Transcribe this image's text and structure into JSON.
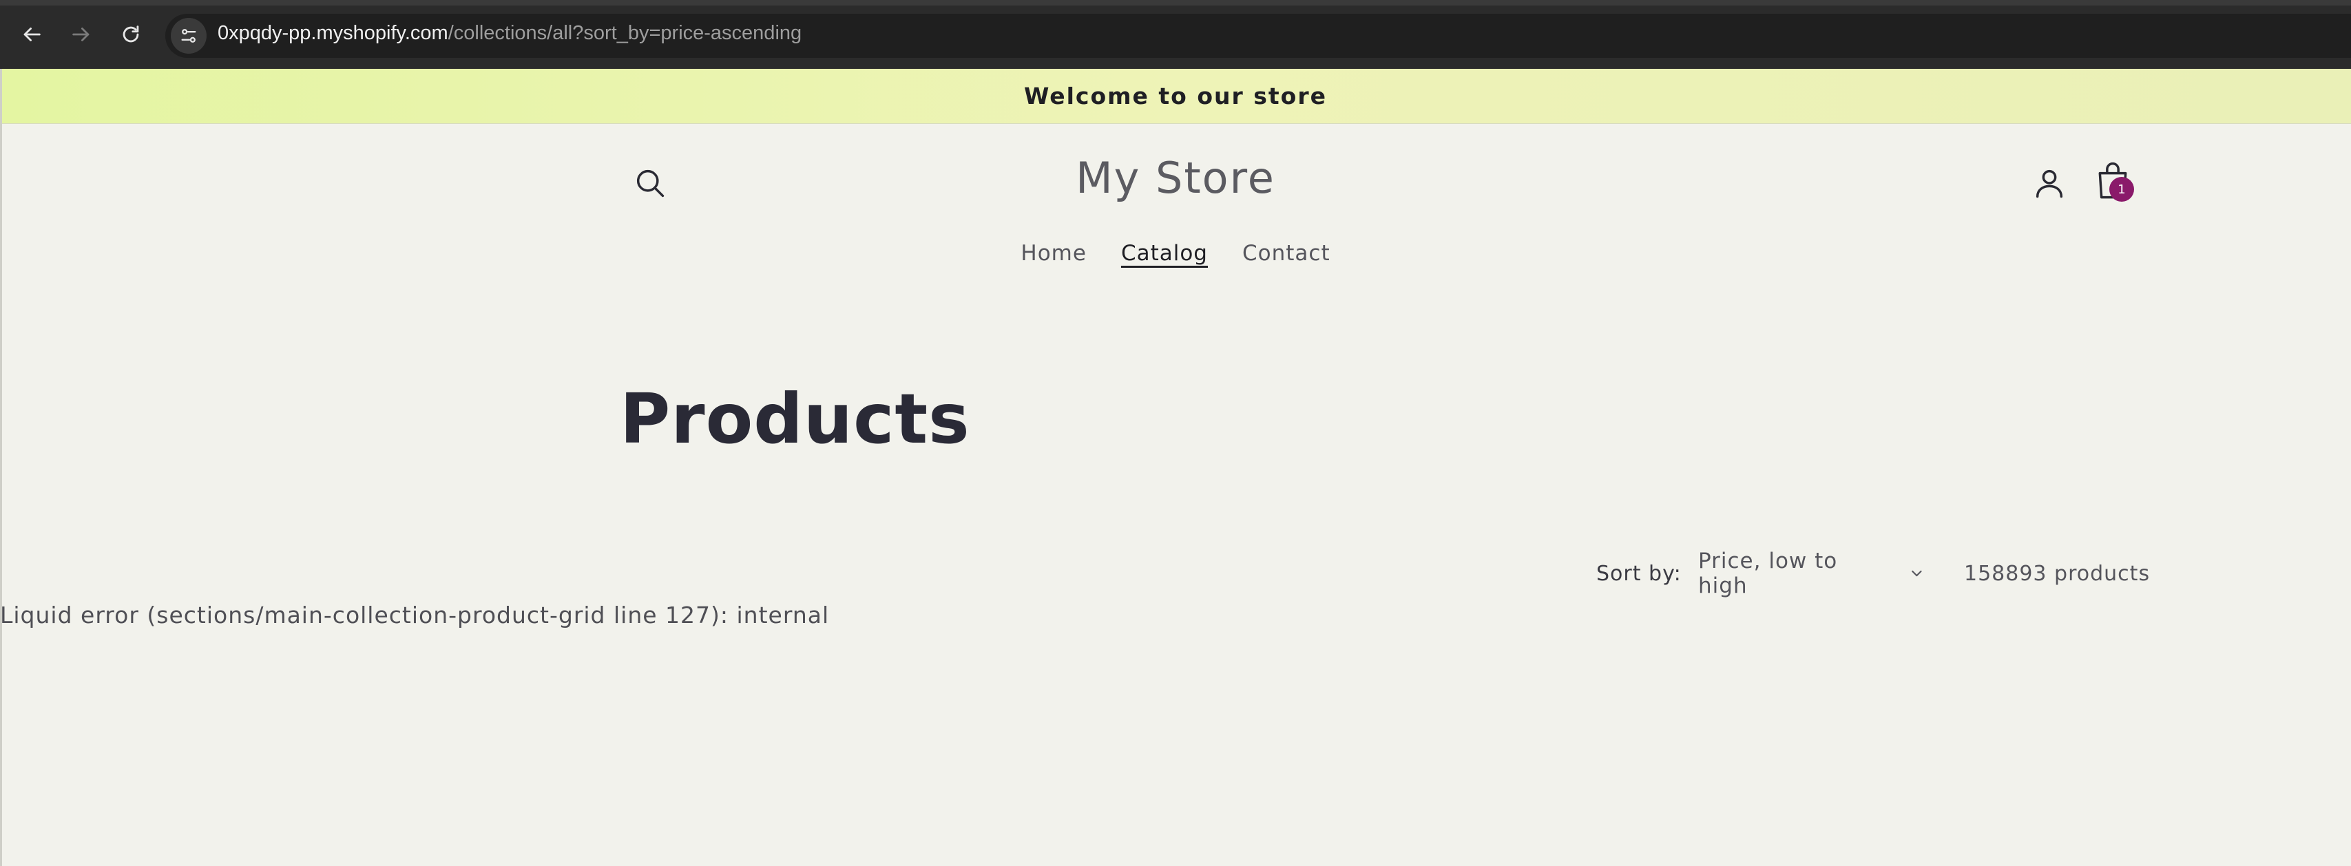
{
  "browser": {
    "url_host": "0xpqdy-pp.myshopify.com",
    "url_path": "/collections/all?sort_by=price-ascending",
    "icons": {
      "back": "arrow-left-icon",
      "forward": "arrow-right-icon",
      "reload": "reload-icon",
      "site_info": "tune-icon"
    }
  },
  "announcement": {
    "text": "Welcome to our store"
  },
  "header": {
    "store_name": "My Store",
    "cart_count": "1",
    "icons": {
      "search": "search-icon",
      "account": "account-icon",
      "cart": "shopping-bag-icon"
    }
  },
  "nav": {
    "items": [
      {
        "label": "Home",
        "active": false
      },
      {
        "label": "Catalog",
        "active": true
      },
      {
        "label": "Contact",
        "active": false
      }
    ]
  },
  "collection": {
    "title": "Products",
    "sort_label": "Sort by:",
    "sort_value": "Price, low to high",
    "product_count": "158893 products",
    "error_message": "Liquid error (sections/main-collection-product-grid line 127): internal"
  },
  "colors": {
    "page_bg": "#f2f2ec",
    "announcement_bg": "#e8f4b0",
    "cart_badge": "#8a1a6a",
    "browser_bar": "#2b2b2b"
  }
}
